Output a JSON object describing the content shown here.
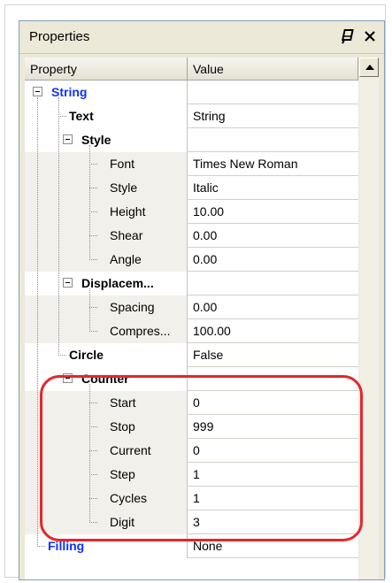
{
  "panel": {
    "title": "Properties",
    "pin_icon": "pin-icon",
    "close_icon": "close-icon"
  },
  "grid": {
    "columns": {
      "property": "Property",
      "value": "Value"
    },
    "rows": [
      {
        "label": "String",
        "value": ""
      },
      {
        "label": "Text",
        "value": "String"
      },
      {
        "label": "Style",
        "value": ""
      },
      {
        "label": "Font",
        "value": "Times New Roman"
      },
      {
        "label": "Style",
        "value": "Italic"
      },
      {
        "label": "Height",
        "value": "10.00"
      },
      {
        "label": "Shear",
        "value": "0.00"
      },
      {
        "label": "Angle",
        "value": "0.00"
      },
      {
        "label": "Displacem...",
        "value": ""
      },
      {
        "label": "Spacing",
        "value": "0.00"
      },
      {
        "label": "Compres...",
        "value": "100.00"
      },
      {
        "label": "Circle",
        "value": "False"
      },
      {
        "label": "Counter",
        "value": ""
      },
      {
        "label": "Start",
        "value": "0"
      },
      {
        "label": "Stop",
        "value": "999"
      },
      {
        "label": "Current",
        "value": "0"
      },
      {
        "label": "Step",
        "value": "1"
      },
      {
        "label": "Cycles",
        "value": "1"
      },
      {
        "label": "Digit",
        "value": "3"
      },
      {
        "label": "Filling",
        "value": "None"
      }
    ]
  },
  "colors": {
    "category_blue": "#1030ff",
    "highlight_red": "#e6262a"
  }
}
